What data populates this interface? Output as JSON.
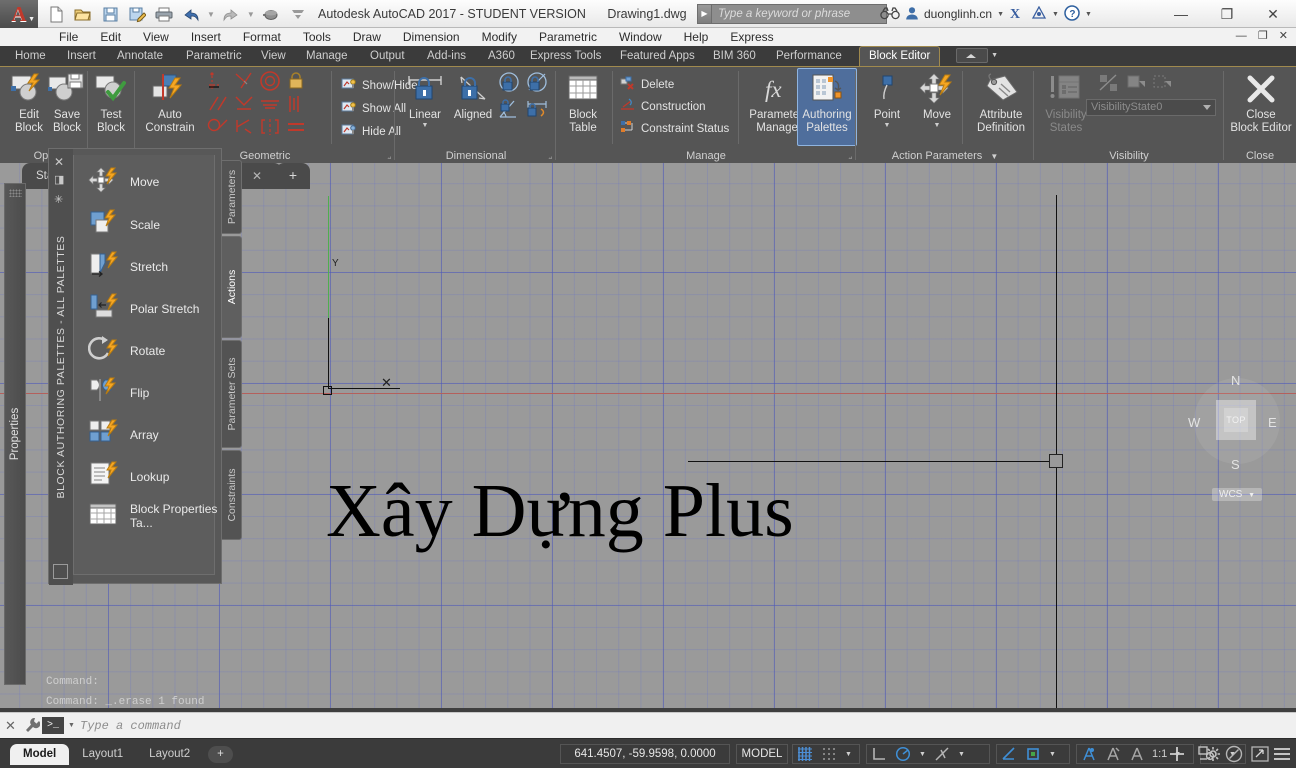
{
  "title_bar": {
    "app_title": "Autodesk AutoCAD 2017 - STUDENT VERSION",
    "document": "Drawing1.dwg",
    "search_placeholder": "Type a keyword or phrase",
    "account": "duonglinh.cn",
    "quick_access": [
      "new-icon",
      "open-icon",
      "save-icon",
      "save-as-icon",
      "plot-icon",
      "undo-icon",
      "redo-icon",
      "workspace-icon",
      "customize-icon"
    ],
    "window_buttons": [
      "minimize",
      "maximize",
      "close"
    ]
  },
  "menu_bar": {
    "items": [
      "File",
      "Edit",
      "View",
      "Insert",
      "Format",
      "Tools",
      "Draw",
      "Dimension",
      "Modify",
      "Parametric",
      "Window",
      "Help",
      "Express"
    ]
  },
  "ribbon_tabs": {
    "items": [
      "Home",
      "Insert",
      "Annotate",
      "Parametric",
      "View",
      "Manage",
      "Output",
      "Add-ins",
      "A360",
      "Express Tools",
      "Featured Apps",
      "BIM 360",
      "Performance",
      "Block Editor"
    ],
    "active": "Block Editor"
  },
  "ribbon": {
    "panels": [
      {
        "name": "Open/Save",
        "title": "Ope",
        "buttons": [
          {
            "label_line1": "Edit",
            "label_line2": "Block",
            "icon": "edit-block-icon"
          },
          {
            "label_line1": "Save",
            "label_line2": "Block",
            "icon": "save-block-icon"
          },
          {
            "label_line1": "Test",
            "label_line2": "Block",
            "icon": "test-block-icon"
          }
        ]
      },
      {
        "name": "Geometric",
        "title": "Geometric",
        "buttons": [
          {
            "label_line1": "Auto",
            "label_line2": "Constrain",
            "icon": "auto-constrain-icon"
          }
        ],
        "small_buttons": [
          "Show/Hide",
          "Show All",
          "Hide All"
        ]
      },
      {
        "name": "Dimensional",
        "title": "Dimensional",
        "buttons": [
          {
            "label_line1": "Linear",
            "label_line2": "",
            "icon": "linear-constraint-icon"
          },
          {
            "label_line1": "Aligned",
            "label_line2": "",
            "icon": "aligned-constraint-icon"
          }
        ]
      },
      {
        "name": "Manage",
        "title": "Manage",
        "buttons": [
          {
            "label_line1": "Block",
            "label_line2": "Table",
            "icon": "block-table-icon"
          },
          {
            "label_line1": "Parameters",
            "label_line2": "Manager",
            "icon": "parameters-manager-icon"
          },
          {
            "label_line1": "Authoring",
            "label_line2": "Palettes",
            "icon": "authoring-palettes-icon",
            "active": true
          }
        ],
        "small_buttons": [
          "Delete",
          "Construction",
          "Constraint Status"
        ]
      },
      {
        "name": "Action Parameters",
        "title": "Action Parameters",
        "buttons": [
          {
            "label_line1": "Point",
            "label_line2": "",
            "icon": "point-parameter-icon"
          },
          {
            "label_line1": "Move",
            "label_line2": "",
            "icon": "move-action-icon"
          },
          {
            "label_line1": "Attribute",
            "label_line2": "Definition",
            "icon": "attribute-definition-icon"
          }
        ]
      },
      {
        "name": "Visibility",
        "title": "Visibility",
        "buttons": [
          {
            "label_line1": "Visibility",
            "label_line2": "States",
            "icon": "visibility-states-icon",
            "disabled": true
          }
        ],
        "combo_value": "VisibilityState0"
      },
      {
        "name": "Close",
        "title": "Close",
        "buttons": [
          {
            "label_line1": "Close",
            "label_line2": "Block Editor",
            "icon": "close-block-editor-icon"
          }
        ]
      }
    ]
  },
  "drawing_tabs": {
    "start_tab": "Sta",
    "new_tab": "+"
  },
  "properties_panel": {
    "label": "Properties"
  },
  "palette": {
    "title": "BLOCK AUTHORING PALETTES - ALL PALETTES",
    "items": [
      {
        "label": "Move",
        "icon": "move-action-icon"
      },
      {
        "label": "Scale",
        "icon": "scale-action-icon"
      },
      {
        "label": "Stretch",
        "icon": "stretch-action-icon"
      },
      {
        "label": "Polar Stretch",
        "icon": "polar-stretch-action-icon"
      },
      {
        "label": "Rotate",
        "icon": "rotate-action-icon"
      },
      {
        "label": "Flip",
        "icon": "flip-action-icon"
      },
      {
        "label": "Array",
        "icon": "array-action-icon"
      },
      {
        "label": "Lookup",
        "icon": "lookup-action-icon"
      },
      {
        "label": "Block Properties Ta...",
        "icon": "block-properties-table-icon"
      }
    ],
    "tabs": [
      {
        "label": "Parameters",
        "selected": false
      },
      {
        "label": "Actions",
        "selected": true
      },
      {
        "label": "Parameter Sets",
        "selected": false
      },
      {
        "label": "Constraints",
        "selected": false
      }
    ]
  },
  "canvas": {
    "drawing_text": "Xây Dựng Plus",
    "viewcube": {
      "face": "TOP",
      "north": "N",
      "south": "S",
      "east": "E",
      "west": "W",
      "ucs": "WCS"
    }
  },
  "command_line": {
    "history": [
      "Command:",
      "Command: _.erase 1 found"
    ],
    "placeholder": "Type a command",
    "prompt_glyph": ">_"
  },
  "status_bar": {
    "layout_tabs": [
      "Model",
      "Layout1",
      "Layout2"
    ],
    "active_layout": "Model",
    "add_layout": "+",
    "coordinates": "641.4507, -59.9598, 0.0000",
    "space": "MODEL",
    "annotation_scale": "1:1",
    "toggles": [
      "grid-display-icon",
      "snap-mode-icon",
      "ortho-mode-icon",
      "polar-tracking-icon",
      "object-snap-icon",
      "object-snap-tracking-icon",
      "lineweight-icon",
      "transparency-icon",
      "selection-cycling-icon",
      "annotation-visibility-icon",
      "autoscale-icon",
      "workspace-switching-icon",
      "hardware-acceleration-icon",
      "isolate-objects-icon",
      "fullscreen-icon",
      "customization-icon"
    ]
  },
  "colors": {
    "accent_blue": "#4f6e9c",
    "ribbon_bg": "#555555",
    "canvas_bg": "#9a9a9a",
    "grid_line": "#6e78c3",
    "x_axis": "#b4605c",
    "y_axis": "#4fae4f",
    "tab_underline": "#a08a4e"
  }
}
